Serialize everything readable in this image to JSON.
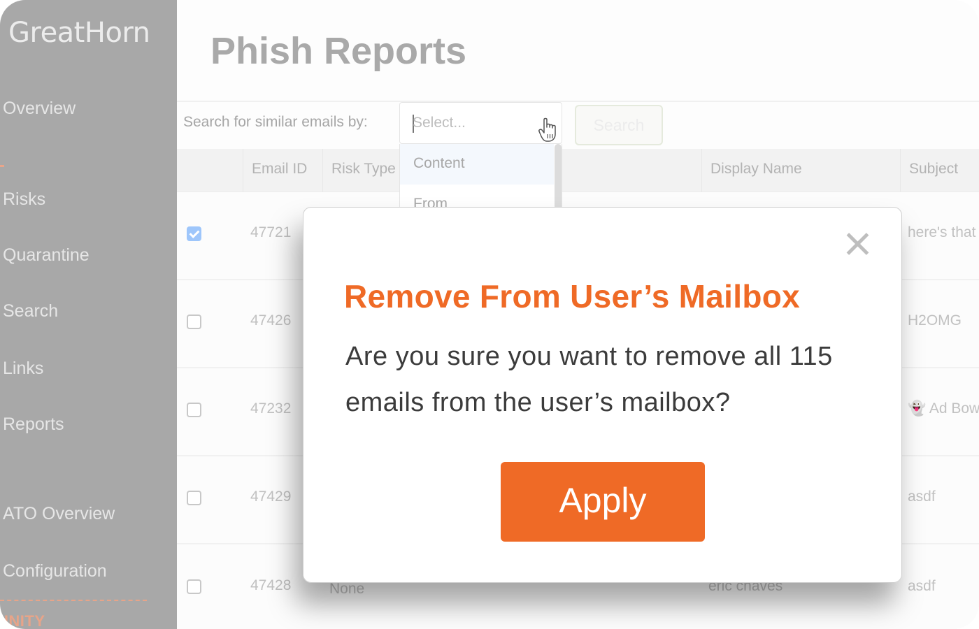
{
  "app": {
    "logo_text": "GreatHorn"
  },
  "sidebar": {
    "items": [
      {
        "label": "Overview"
      },
      {
        "label": "Risks"
      },
      {
        "label": "Quarantine"
      },
      {
        "label": "Search"
      },
      {
        "label": "Links"
      },
      {
        "label": "Reports"
      },
      {
        "label": "ATO Overview"
      },
      {
        "label": "Configuration"
      }
    ],
    "section_label": "UNITY",
    "accent_color": "#e7a489"
  },
  "page": {
    "title": "Phish Reports"
  },
  "toolbar": {
    "search_label": "Search for similar emails by:",
    "select_placeholder": "Select...",
    "search_button": "Search",
    "dropdown_options": [
      "Content",
      "From"
    ]
  },
  "table": {
    "columns": [
      "Email ID",
      "Risk Type",
      "Display Name",
      "Subject"
    ],
    "rows": [
      {
        "checked": true,
        "email_id": "47721",
        "risk_type": "",
        "display_name": "",
        "subject": "here's that"
      },
      {
        "checked": false,
        "email_id": "47426",
        "risk_type": "",
        "display_name": "",
        "subject": "H2OMG"
      },
      {
        "checked": false,
        "email_id": "47232",
        "risk_type": "",
        "display_name": "",
        "subject": "👻 Ad Bow"
      },
      {
        "checked": false,
        "email_id": "47429",
        "risk_type": "",
        "display_name": "",
        "subject": "asdf"
      },
      {
        "checked": false,
        "email_id": "47428",
        "risk_type": "None",
        "display_name": "eric chaves",
        "subject": "asdf"
      }
    ]
  },
  "modal": {
    "title": "Remove From User’s Mailbox",
    "body": "Are you sure you want to remove all 115 emails from the user’s mailbox?",
    "email_count": 115,
    "apply_label": "Apply",
    "accent_color": "#ef6a26"
  }
}
